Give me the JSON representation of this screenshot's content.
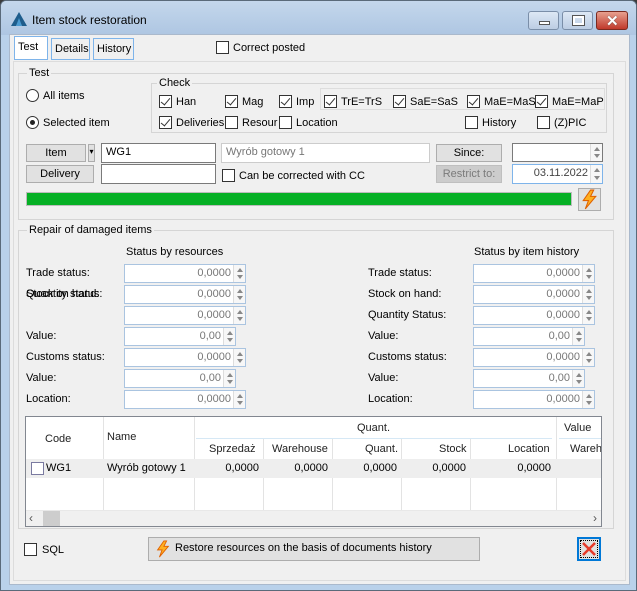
{
  "window": {
    "title": "Item stock restoration",
    "controls": {
      "minimize": "minimize",
      "maximize": "maximize",
      "close": "close"
    }
  },
  "tabs": [
    {
      "label": "Test",
      "active": true
    },
    {
      "label": "Details",
      "active": false
    },
    {
      "label": "History",
      "active": false
    }
  ],
  "correct_posted": {
    "label": "Correct posted",
    "checked": false
  },
  "test_group": {
    "title": "Test",
    "radio_all": {
      "label": "All items",
      "selected": false
    },
    "radio_selected": {
      "label": "Selected item",
      "selected": true
    },
    "check_group": {
      "title": "Check",
      "items": [
        {
          "label": "Han",
          "checked": true
        },
        {
          "label": "Mag",
          "checked": true
        },
        {
          "label": "Imp",
          "checked": true
        },
        {
          "label": "TrE=TrS",
          "checked": true
        },
        {
          "label": "SaE=SaS",
          "checked": true
        },
        {
          "label": "MaE=MaS",
          "checked": true
        },
        {
          "label": "MaE=MaP",
          "checked": true
        },
        {
          "label": "Deliveries",
          "checked": true
        },
        {
          "label": "Resour",
          "checked": false
        },
        {
          "label": "Location",
          "checked": false
        },
        {
          "label": "History",
          "checked": false
        },
        {
          "label": "(Z)PIC",
          "checked": false
        }
      ]
    },
    "item_button": "Item",
    "item_code": "WG1",
    "item_name": "Wyrób gotowy 1",
    "delivery_button": "Delivery",
    "delivery_value": "",
    "can_be_corrected": {
      "label": "Can be corrected with CC",
      "checked": false
    },
    "since_button": "Since:",
    "since_value": "",
    "restrict_button": "Restrict to:",
    "restrict_value": "03.11.2022",
    "progress_percent": 100,
    "progress_color": "#06b025"
  },
  "repair_group": {
    "title": "Repair of damaged items",
    "left_header": "Status by resources",
    "right_header": "Status by item history",
    "left": [
      {
        "label": "Trade status:",
        "value": "0,0000"
      },
      {
        "label": "Stock on hand:",
        "overlap_label": "Quantity status:",
        "value": "0,0000"
      },
      {
        "label": "",
        "value": "0,0000"
      },
      {
        "label": "Value:",
        "value": "0,00"
      },
      {
        "label": "Customs status:",
        "value": "0,0000"
      },
      {
        "label": "Value:",
        "value": "0,00"
      },
      {
        "label": "Location:",
        "value": "0,0000"
      }
    ],
    "right": [
      {
        "label": "Trade status:",
        "value": "0,0000"
      },
      {
        "label": "Stock on hand:",
        "value": "0,0000"
      },
      {
        "label": "Quantity Status:",
        "value": "0,0000"
      },
      {
        "label": "Value:",
        "value": "0,00"
      },
      {
        "label": "Customs status:",
        "value": "0,0000"
      },
      {
        "label": "Value:",
        "value": "0,00"
      },
      {
        "label": "Location:",
        "value": "0,0000"
      }
    ]
  },
  "grid": {
    "group_headers": {
      "quant": "Quant.",
      "value": "Value"
    },
    "columns": [
      "Code",
      "Name",
      "Sprzedaż",
      "Warehouse",
      "Quant.",
      "Stock",
      "Location",
      "Wareh"
    ],
    "rows": [
      {
        "checked": false,
        "code": "WG1",
        "name": "Wyrób gotowy 1",
        "sprzedaz": "0,0000",
        "warehouse": "0,0000",
        "quant": "0,0000",
        "stock": "0,0000",
        "location": "0,0000",
        "wareh": ""
      }
    ]
  },
  "footer": {
    "sql": {
      "label": "SQL",
      "checked": false
    },
    "restore_button": "Restore resources on the basis of documents history",
    "close_icon": "close-x-icon"
  }
}
